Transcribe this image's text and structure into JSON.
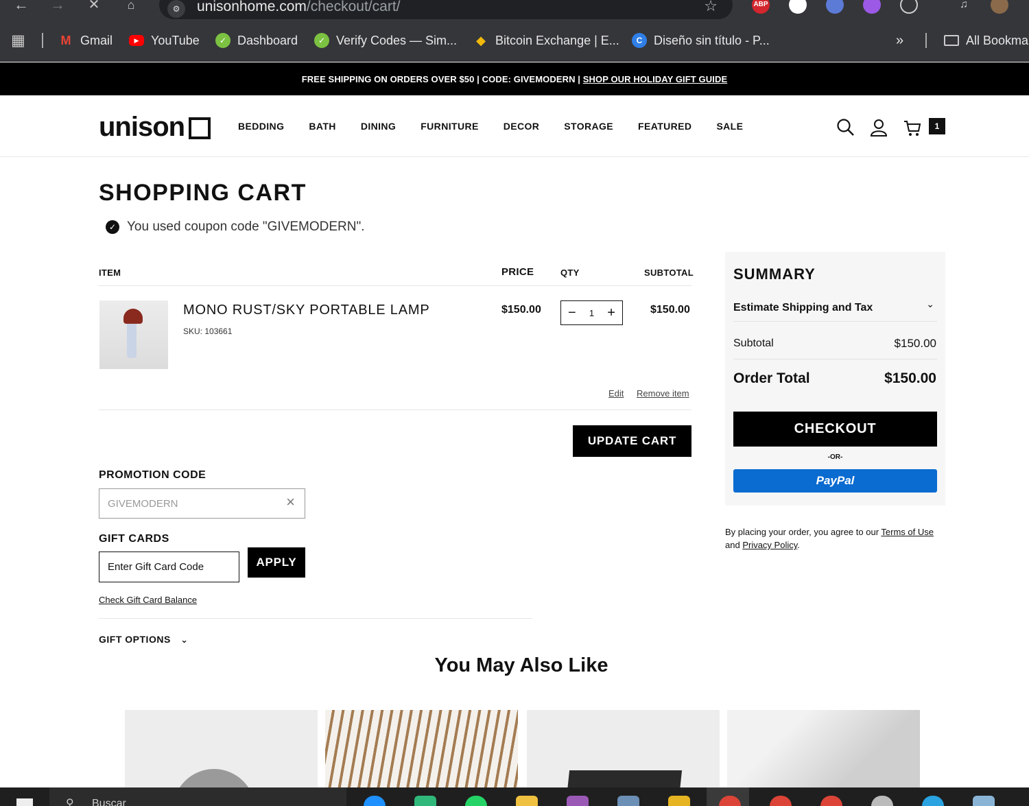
{
  "browser": {
    "url_domain": "unisonhome.com",
    "url_path": "/checkout/cart/",
    "bookmarks": [
      {
        "label": "Gmail",
        "icon": "gmail-icon"
      },
      {
        "label": "YouTube",
        "icon": "youtube-icon"
      },
      {
        "label": "Dashboard",
        "icon": "check-badge-icon"
      },
      {
        "label": "Verify Codes — Sim...",
        "icon": "check-badge-icon"
      },
      {
        "label": "Bitcoin Exchange | E...",
        "icon": "binance-icon"
      },
      {
        "label": "Diseño sin título - P...",
        "icon": "canva-icon"
      }
    ],
    "all_bookmarks": "All Bookma",
    "extensions": [
      "ABP"
    ]
  },
  "promo": {
    "text": "FREE SHIPPING ON ORDERS OVER $50 | CODE: GIVEMODERN | ",
    "link": "SHOP OUR HOLIDAY GIFT GUIDE"
  },
  "header": {
    "logo": "unison",
    "menu": [
      "BEDDING",
      "BATH",
      "DINING",
      "FURNITURE",
      "DECOR",
      "STORAGE",
      "FEATURED",
      "SALE"
    ],
    "cart_count": "1"
  },
  "cart": {
    "title": "SHOPPING CART",
    "notice": "You used coupon code \"GIVEMODERN\".",
    "columns": {
      "item": "ITEM",
      "price": "PRICE",
      "qty": "QTY",
      "subtotal": "SUBTOTAL"
    },
    "item": {
      "name": "MONO RUST/SKY PORTABLE LAMP",
      "sku": "SKU: 103661",
      "price": "$150.00",
      "qty": "1",
      "subtotal": "$150.00",
      "edit": "Edit",
      "remove": "Remove item"
    },
    "update_button": "UPDATE CART"
  },
  "promotion": {
    "heading": "PROMOTION CODE",
    "value": "GIVEMODERN"
  },
  "gift_cards": {
    "heading": "GIFT CARDS",
    "placeholder": "Enter Gift Card Code",
    "apply": "APPLY",
    "balance_link": "Check Gift Card Balance"
  },
  "gift_options": "GIFT OPTIONS",
  "summary": {
    "title": "SUMMARY",
    "estimate": "Estimate Shipping and Tax",
    "subtotal_label": "Subtotal",
    "subtotal_value": "$150.00",
    "total_label": "Order Total",
    "total_value": "$150.00",
    "checkout": "CHECKOUT",
    "or": "-OR-",
    "paypal": "PayPal"
  },
  "terms": {
    "prefix": "By placing your order, you agree to our ",
    "terms_link": "Terms of Use",
    "middle": " and ",
    "privacy_link": "Privacy Policy",
    "suffix": "."
  },
  "recommendations": {
    "heading": "You May Also Like"
  },
  "taskbar": {
    "search_text": "Buscar"
  },
  "colors": {
    "black": "#000000",
    "paypal_blue": "#0a6bd1",
    "summary_bg": "#f6f6f6",
    "chrome_dark": "#35363a"
  }
}
